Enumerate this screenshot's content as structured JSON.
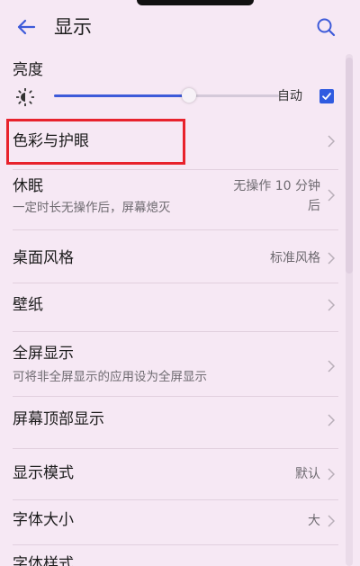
{
  "header": {
    "title": "显示"
  },
  "brightness": {
    "label": "亮度",
    "level": 0.6,
    "auto_label": "自动",
    "auto_checked": true
  },
  "rows": {
    "color_eye": {
      "label": "色彩与护眼"
    },
    "sleep": {
      "label": "休眠",
      "sub": "一定时长无操作后，屏幕熄灭",
      "value_line1": "无操作 10 分钟",
      "value_line2": "后"
    },
    "desktop_style": {
      "label": "桌面风格",
      "value": "标准风格"
    },
    "wallpaper": {
      "label": "壁纸"
    },
    "fullscreen": {
      "label": "全屏显示",
      "sub": "可将非全屏显示的应用设为全屏显示"
    },
    "top_display": {
      "label": "屏幕顶部显示"
    },
    "display_mode": {
      "label": "显示模式",
      "value": "默认"
    },
    "font_size": {
      "label": "字体大小",
      "value": "大"
    },
    "font_style": {
      "label": "字体样式"
    }
  },
  "colors": {
    "accent": "#2f5be0",
    "highlight": "#e8222c",
    "background": "#f6e8f4"
  },
  "icons": {
    "back": "back-arrow-icon",
    "search": "search-icon",
    "brightness": "sun-icon",
    "chevron": "chevron-right-icon"
  }
}
